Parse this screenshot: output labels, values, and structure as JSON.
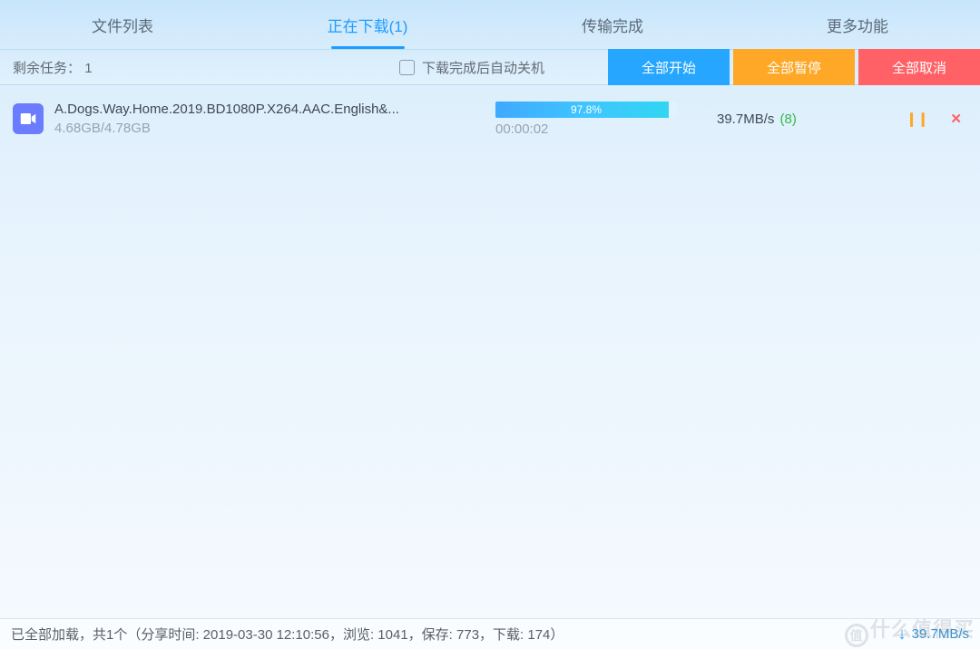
{
  "tabs": {
    "file_list": "文件列表",
    "downloading": "正在下载(1)",
    "completed": "传输完成",
    "more": "更多功能"
  },
  "controls": {
    "remaining_label": "剩余任务：",
    "remaining_count": "1",
    "shutdown_label": "下载完成后自动关机",
    "start_all": "全部开始",
    "pause_all": "全部暂停",
    "cancel_all": "全部取消"
  },
  "item": {
    "filename": "A.Dogs.Way.Home.2019.BD1080P.X264.AAC.English&...",
    "size": "4.68GB/4.78GB",
    "percent": "97.8%",
    "time_left": "00:00:02",
    "speed": "39.7MB/s",
    "threads": "(8)",
    "icon": "video-icon"
  },
  "footer": {
    "status": "已全部加载，共1个（分享时间: 2019-03-30 12:10:56，浏览: 1041，保存: 773，下载: 174）",
    "total_speed": "39.7MB/s"
  },
  "watermark": "什么值得买"
}
